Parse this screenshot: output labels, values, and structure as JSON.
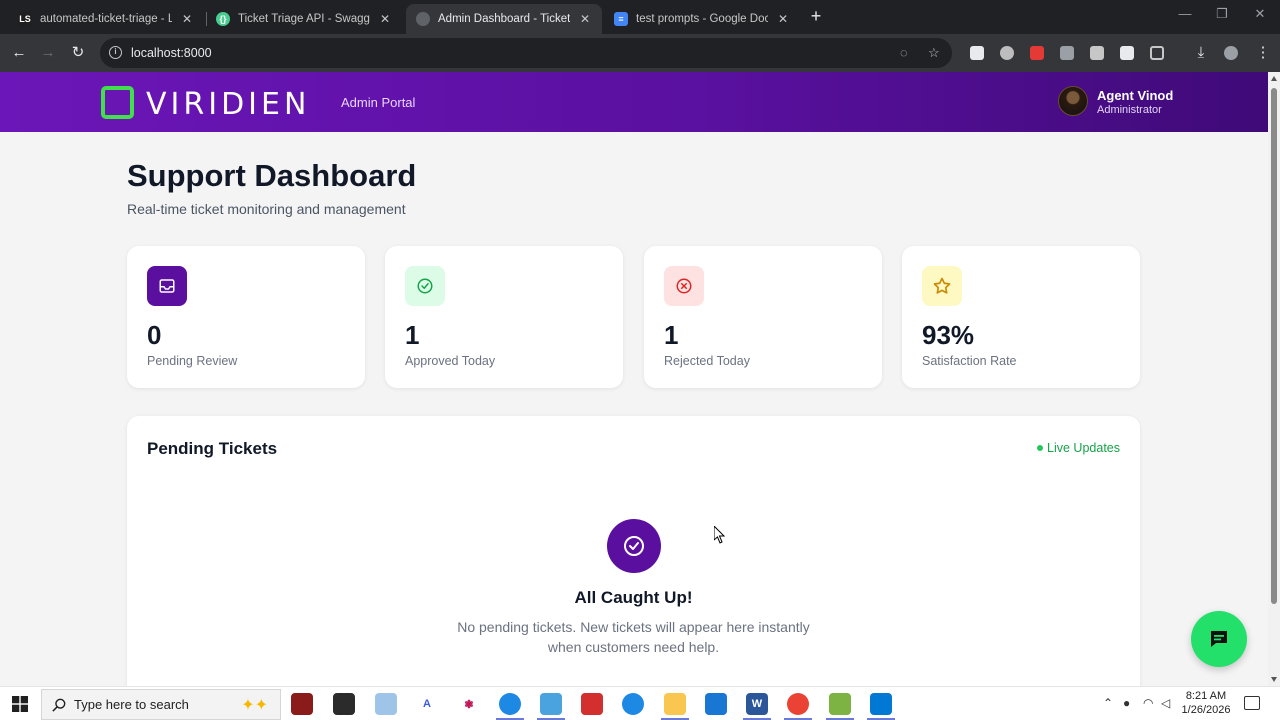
{
  "browser": {
    "tabs": [
      {
        "title": "automated-ticket-triage - Lang",
        "active": false
      },
      {
        "title": "Ticket Triage API - Swagger UI",
        "active": false
      },
      {
        "title": "Admin Dashboard - Ticket Triag",
        "active": true
      },
      {
        "title": "test prompts - Google Docs",
        "active": false
      }
    ],
    "url": "localhost:8000"
  },
  "header": {
    "logo_text": "VIRIDIEN",
    "portal_label": "Admin Portal",
    "user": {
      "name": "Agent Vinod",
      "role": "Administrator"
    }
  },
  "page": {
    "title": "Support Dashboard",
    "subtitle": "Real-time ticket monitoring and management"
  },
  "stats": [
    {
      "value": "0",
      "label": "Pending Review",
      "icon": "inbox-icon",
      "color": "#5b0f9e"
    },
    {
      "value": "1",
      "label": "Approved Today",
      "icon": "check-circle-icon",
      "color": "#16a34a"
    },
    {
      "value": "1",
      "label": "Rejected Today",
      "icon": "x-circle-icon",
      "color": "#dc2626"
    },
    {
      "value": "93%",
      "label": "Satisfaction Rate",
      "icon": "star-icon",
      "color": "#ca8a04"
    }
  ],
  "pending": {
    "title": "Pending Tickets",
    "live_label": "Live Updates",
    "empty_title": "All Caught Up!",
    "empty_text": "No pending tickets. New tickets will appear here instantly when customers need help."
  },
  "taskbar": {
    "search_placeholder": "Type here to search",
    "time": "8:21 AM",
    "date": "1/26/2026"
  },
  "colors": {
    "brand_purple": "#5b0f9e",
    "logo_green": "#3fe04a",
    "chat_green": "#22e06a"
  }
}
